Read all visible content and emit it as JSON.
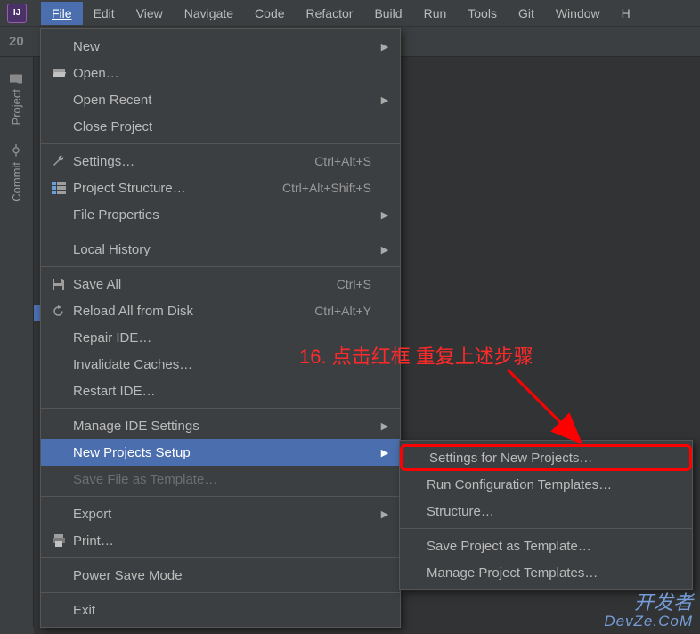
{
  "menubar": {
    "items": [
      "File",
      "Edit",
      "View",
      "Navigate",
      "Code",
      "Refactor",
      "Build",
      "Run",
      "Tools",
      "Git",
      "Window",
      "H"
    ],
    "active_index": 0
  },
  "secondary": {
    "label": "20"
  },
  "side_tabs": {
    "project": "Project",
    "commit": "Commit"
  },
  "file_menu": {
    "new": "New",
    "open": "Open…",
    "open_recent": "Open Recent",
    "close_project": "Close Project",
    "settings": "Settings…",
    "settings_shortcut": "Ctrl+Alt+S",
    "project_structure": "Project Structure…",
    "project_structure_shortcut": "Ctrl+Alt+Shift+S",
    "file_properties": "File Properties",
    "local_history": "Local History",
    "save_all": "Save All",
    "save_all_shortcut": "Ctrl+S",
    "reload": "Reload All from Disk",
    "reload_shortcut": "Ctrl+Alt+Y",
    "repair_ide": "Repair IDE…",
    "invalidate_caches": "Invalidate Caches…",
    "restart_ide": "Restart IDE…",
    "manage_ide": "Manage IDE Settings",
    "new_projects_setup": "New Projects Setup",
    "save_as_template": "Save File as Template…",
    "export": "Export",
    "print": "Print…",
    "power_save": "Power Save Mode",
    "exit": "Exit"
  },
  "submenu": {
    "settings_for_new": "Settings for New Projects…",
    "run_config": "Run Configuration Templates…",
    "structure": "Structure…",
    "save_project_template": "Save Project as Template…",
    "manage_project_templates": "Manage Project Templates…"
  },
  "annotation": {
    "text": "16. 点击红框 重复上述步骤"
  },
  "watermark": {
    "line1": "开发者",
    "line2": "DevZe.CoM"
  }
}
